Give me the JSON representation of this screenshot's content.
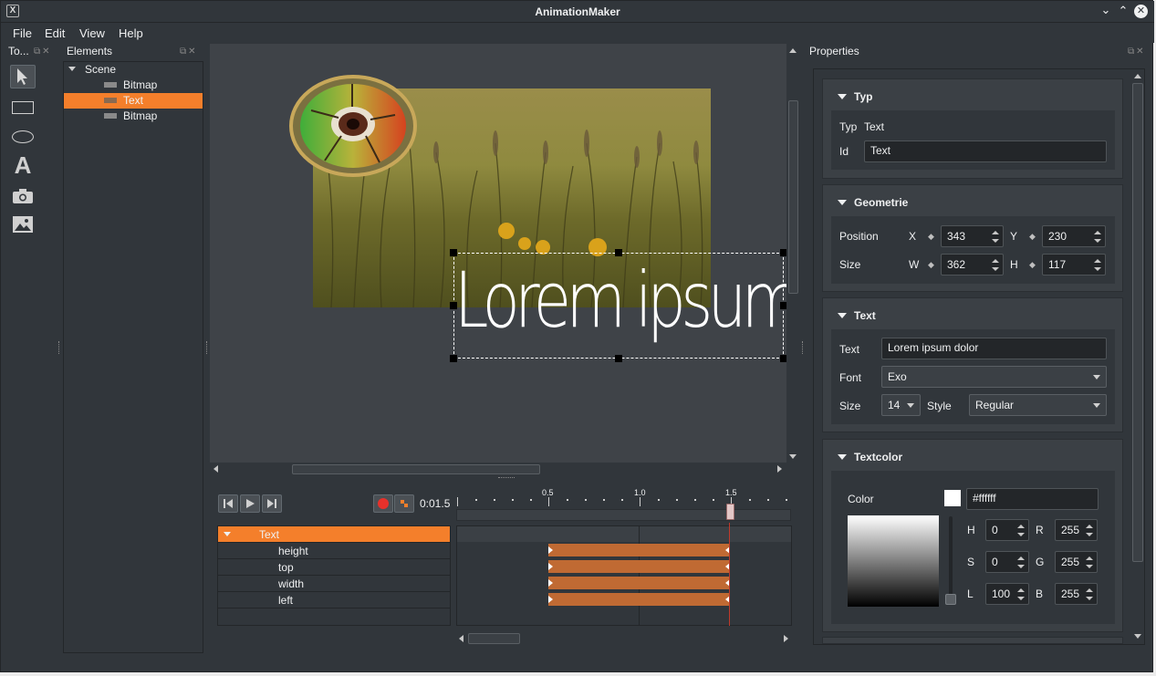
{
  "window": {
    "title": "AnimationMaker"
  },
  "menu": [
    "File",
    "Edit",
    "View",
    "Help"
  ],
  "tools_dock": {
    "title": "To..."
  },
  "elements_dock": {
    "title": "Elements",
    "root": "Scene",
    "items": [
      "Bitmap",
      "Text",
      "Bitmap"
    ],
    "selected_index": 1
  },
  "canvas": {
    "text": "Lorem ipsum"
  },
  "properties": {
    "title": "Properties",
    "typ": {
      "header": "Typ",
      "typ_label": "Typ",
      "typ_value": "Text",
      "id_label": "Id",
      "id_value": "Text"
    },
    "geometry": {
      "header": "Geometrie",
      "position_label": "Position",
      "size_label": "Size",
      "x_label": "X",
      "y_label": "Y",
      "w_label": "W",
      "h_label": "H",
      "x": "343",
      "y": "230",
      "w": "362",
      "h": "117"
    },
    "text": {
      "header": "Text",
      "text_label": "Text",
      "text_value": "Lorem ipsum dolor",
      "font_label": "Font",
      "font_value": "Exo",
      "size_label": "Size",
      "size_value": "14",
      "style_label": "Style",
      "style_value": "Regular"
    },
    "textcolor": {
      "header": "Textcolor",
      "color_label": "Color",
      "color_value": "#ffffff",
      "h_label": "H",
      "s_label": "S",
      "l_label": "L",
      "r_label": "R",
      "g_label": "G",
      "b_label": "B",
      "h": "0",
      "s": "0",
      "l": "100",
      "r": "255",
      "g": "255",
      "b": "255"
    }
  },
  "timeline": {
    "time": "0:01.5",
    "ruler": [
      "0.5",
      "1.0",
      "1.5"
    ],
    "rows": [
      "Text",
      "height",
      "top",
      "width",
      "left"
    ]
  },
  "colors": {
    "accent": "#f47f2b",
    "keyframe": "#c06a33",
    "background": "#31363b",
    "playhead": "#c0392b"
  }
}
